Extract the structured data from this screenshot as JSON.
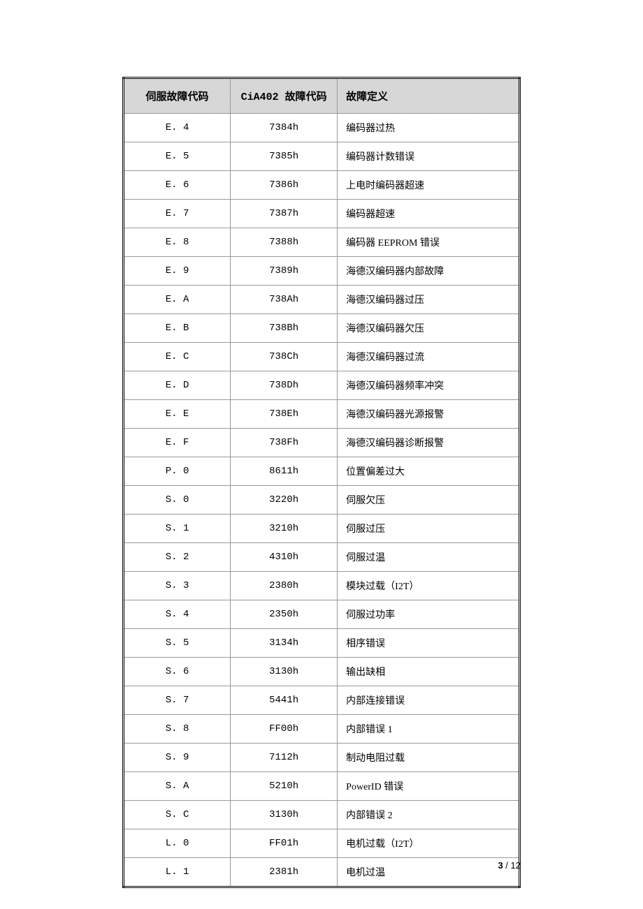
{
  "table": {
    "headers": {
      "col1": "伺服故障代码",
      "col2": "CiA402 故障代码",
      "col3": "故障定义"
    },
    "rows": [
      {
        "servo": "E. 4",
        "cia": "7384h",
        "def": "编码器过热"
      },
      {
        "servo": "E. 5",
        "cia": "7385h",
        "def": "编码器计数错误"
      },
      {
        "servo": "E. 6",
        "cia": "7386h",
        "def": "上电时编码器超速"
      },
      {
        "servo": "E. 7",
        "cia": "7387h",
        "def": "编码器超速"
      },
      {
        "servo": "E. 8",
        "cia": "7388h",
        "def": "编码器 EEPROM 错误"
      },
      {
        "servo": "E. 9",
        "cia": "7389h",
        "def": "海德汉编码器内部故障"
      },
      {
        "servo": "E. A",
        "cia": "738Ah",
        "def": "海德汉编码器过压"
      },
      {
        "servo": "E. B",
        "cia": "738Bh",
        "def": "海德汉编码器欠压"
      },
      {
        "servo": "E. C",
        "cia": "738Ch",
        "def": "海德汉编码器过流"
      },
      {
        "servo": "E. D",
        "cia": "738Dh",
        "def": "海德汉编码器频率冲突"
      },
      {
        "servo": "E. E",
        "cia": "738Eh",
        "def": "海德汉编码器光源报警"
      },
      {
        "servo": "E. F",
        "cia": "738Fh",
        "def": "海德汉编码器诊断报警"
      },
      {
        "servo": "P. 0",
        "cia": "8611h",
        "def": "位置偏差过大"
      },
      {
        "servo": "S. 0",
        "cia": "3220h",
        "def": "伺服欠压"
      },
      {
        "servo": "S. 1",
        "cia": "3210h",
        "def": "伺服过压"
      },
      {
        "servo": "S. 2",
        "cia": "4310h",
        "def": "伺服过温"
      },
      {
        "servo": "S. 3",
        "cia": "2380h",
        "def": "模块过载（I2T）"
      },
      {
        "servo": "S. 4",
        "cia": "2350h",
        "def": "伺服过功率"
      },
      {
        "servo": "S. 5",
        "cia": "3134h",
        "def": "相序错误"
      },
      {
        "servo": "S. 6",
        "cia": "3130h",
        "def": "输出缺相"
      },
      {
        "servo": "S. 7",
        "cia": "5441h",
        "def": "内部连接错误"
      },
      {
        "servo": "S. 8",
        "cia": "FF00h",
        "def": "内部错误 1"
      },
      {
        "servo": "S. 9",
        "cia": "7112h",
        "def": "制动电阻过载"
      },
      {
        "servo": "S. A",
        "cia": "5210h",
        "def": "PowerID 错误"
      },
      {
        "servo": "S. C",
        "cia": "3130h",
        "def": "内部错误 2"
      },
      {
        "servo": "L. 0",
        "cia": "FF01h",
        "def": "电机过载（I2T）"
      },
      {
        "servo": "L. 1",
        "cia": "2381h",
        "def": "电机过温"
      }
    ]
  },
  "footer": {
    "current": "3",
    "sep": " / ",
    "total": "12"
  }
}
